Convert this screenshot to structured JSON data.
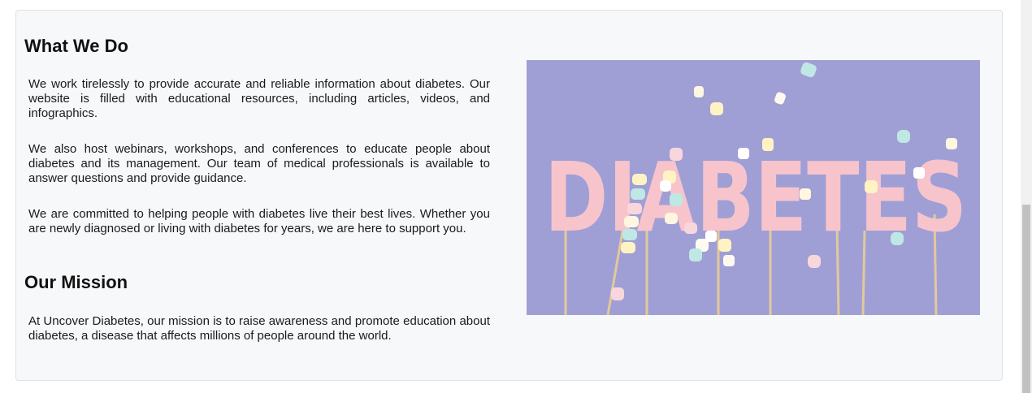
{
  "what_we_do": {
    "heading": "What We Do",
    "paragraphs": [
      "We work tirelessly to provide accurate and reliable information about diabetes. Our website is filled with educational resources, including articles, videos, and infographics.",
      "We also host webinars, workshops, and conferences to educate people about diabetes and its management. Our team of medical professionals is available to answer questions and provide guidance.",
      "We are committed to helping people with diabetes live their best lives. Whether you are newly diagnosed or living with diabetes for years, we are here to support you."
    ]
  },
  "our_mission": {
    "heading": "Our Mission",
    "paragraph": "At Uncover Diabetes, our mission is to raise awareness and promote education about diabetes, a disease that affects millions of people around the world."
  },
  "hero_image": {
    "word": "DIABETES",
    "background_color": "#9f9fd6",
    "letter_color": "#f7c4cc"
  }
}
